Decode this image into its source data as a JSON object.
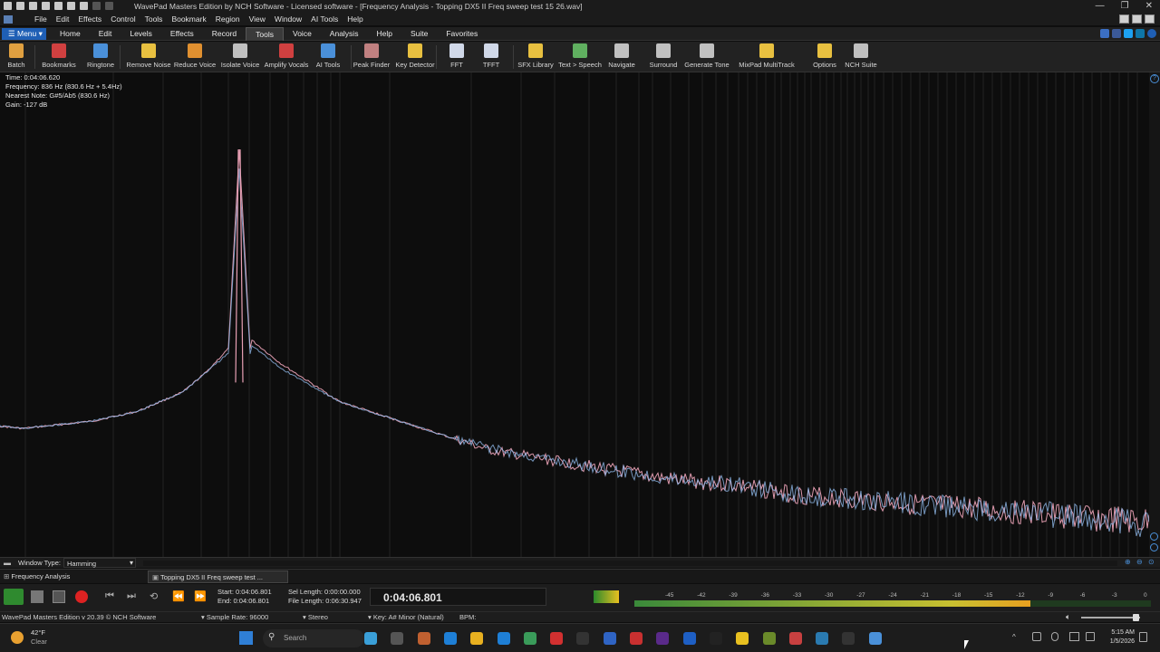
{
  "window": {
    "title": "WavePad Masters Edition by NCH Software - Licensed software - [Frequency Analysis - Topping DX5 II Freq sweep test  15 26.wav]"
  },
  "menubar": {
    "items": [
      "File",
      "Edit",
      "Effects",
      "Control",
      "Tools",
      "Bookmark",
      "Region",
      "View",
      "Window",
      "AI Tools",
      "Help"
    ]
  },
  "ribbon": {
    "menu_label": "Menu",
    "tabs": [
      "Home",
      "Edit",
      "Levels",
      "Effects",
      "Record",
      "Tools",
      "Voice",
      "Analysis",
      "Help",
      "Suite",
      "Favorites"
    ],
    "active_tab": "Tools"
  },
  "toolbar": {
    "tools": [
      {
        "label": "Batch",
        "icon": "batch-icon",
        "color": "#e0a040"
      },
      {
        "label": "Bookmarks",
        "icon": "bookmarks-icon",
        "color": "#d04040"
      },
      {
        "label": "Ringtone",
        "icon": "ringtone-icon",
        "color": "#4a90d9"
      },
      {
        "label": "Remove Noise",
        "icon": "remove-noise-icon",
        "color": "#e8c040"
      },
      {
        "label": "Reduce Voice",
        "icon": "reduce-voice-icon",
        "color": "#e09030"
      },
      {
        "label": "Isolate Voice",
        "icon": "isolate-voice-icon",
        "color": "#c0c0c0"
      },
      {
        "label": "Amplify Vocals",
        "icon": "amplify-vocals-icon",
        "color": "#d04040"
      },
      {
        "label": "AI Tools",
        "icon": "ai-tools-icon",
        "color": "#4a90d9"
      },
      {
        "label": "Peak Finder",
        "icon": "peak-finder-icon",
        "color": "#c08080"
      },
      {
        "label": "Key Detector",
        "icon": "key-detector-icon",
        "color": "#e8c040"
      },
      {
        "label": "FFT",
        "icon": "fft-icon",
        "color": "#d0d8e8"
      },
      {
        "label": "TFFT",
        "icon": "tfft-icon",
        "color": "#d0d8e8"
      },
      {
        "label": "SFX Library",
        "icon": "sfx-library-icon",
        "color": "#e8c040"
      },
      {
        "label": "Text > Speech",
        "icon": "text-to-speech-icon",
        "color": "#60b060"
      },
      {
        "label": "Navigate",
        "icon": "navigate-icon",
        "color": "#c0c0c0"
      },
      {
        "label": "Surround",
        "icon": "surround-icon",
        "color": "#c0c0c0"
      },
      {
        "label": "Generate Tone",
        "icon": "generate-tone-icon",
        "color": "#c0c0c0"
      },
      {
        "label": "MixPad MultiTrack",
        "icon": "mixpad-icon",
        "color": "#e8c040"
      },
      {
        "label": "Options",
        "icon": "options-icon",
        "color": "#e8c040"
      },
      {
        "label": "NCH Suite",
        "icon": "nch-suite-icon",
        "color": "#c0c0c0"
      }
    ]
  },
  "info": {
    "time": "Time: 0:04:06.620",
    "frequency": "Frequency: 836 Hz (830.6 Hz + 5.4Hz)",
    "nearest_note": "Nearest Note: G#5/Ab5 (830.6 Hz)",
    "gain": "Gain: -127 dB"
  },
  "window_type": {
    "label": "Window Type:",
    "value": "Hamming"
  },
  "doc_tabs": {
    "left": "Frequency Analysis",
    "file": "Topping DX5 II Freq sweep test ..."
  },
  "transport": {
    "start": "Start:  0:04:06.801",
    "end": "End:   0:04:06.801",
    "sel_length": "Sel Length:  0:00:00.000",
    "file_length": "File Length:  0:06:30.947",
    "time_display": "0:04:06.801",
    "meter_ticks": [
      "-45",
      "-42",
      "-39",
      "-36",
      "-33",
      "-30",
      "-27",
      "-24",
      "-21",
      "-18",
      "-15",
      "-12",
      "-9",
      "-6",
      "-3",
      "0"
    ]
  },
  "statusbar": {
    "version": "WavePad Masters Edition v 20.39 © NCH Software",
    "sample_rate": "Sample Rate: 96000",
    "channels": "Stereo",
    "key": "Key:  A# Minor (Natural)",
    "bpm": "BPM:"
  },
  "taskbar": {
    "weather_temp": "42°F",
    "weather_cond": "Clear",
    "search_placeholder": "Search",
    "time": "5:15 AM",
    "date": "1/5/2026"
  },
  "chart_data": {
    "type": "line",
    "title": "",
    "xlabel": "",
    "ylabel": "",
    "peak_hz": 836,
    "series": [
      {
        "values": [
          0.73,
          0.735,
          0.73,
          0.725,
          0.72,
          0.71,
          0.7,
          0.68,
          0.66,
          0.62,
          0.57,
          0.16,
          0.55,
          0.6,
          0.64,
          0.68,
          0.7,
          0.72,
          0.74,
          0.76,
          0.78,
          0.79,
          0.8,
          0.81,
          0.82,
          0.83,
          0.84,
          0.845,
          0.85,
          0.86,
          0.87,
          0.875,
          0.88,
          0.885,
          0.89,
          0.895,
          0.9,
          0.905,
          0.91,
          0.915,
          0.92,
          0.925,
          0.93
        ],
        "color": "#e8a0b4"
      },
      {
        "values": [
          0.73,
          0.735,
          0.73,
          0.725,
          0.72,
          0.71,
          0.7,
          0.68,
          0.66,
          0.62,
          0.58,
          0.2,
          0.56,
          0.61,
          0.645,
          0.68,
          0.7,
          0.72,
          0.74,
          0.76,
          0.775,
          0.79,
          0.8,
          0.81,
          0.82,
          0.83,
          0.84,
          0.845,
          0.85,
          0.86,
          0.87,
          0.875,
          0.88,
          0.885,
          0.89,
          0.895,
          0.9,
          0.905,
          0.91,
          0.915,
          0.92,
          0.925,
          0.93
        ],
        "color": "#8fb8e8"
      }
    ]
  }
}
